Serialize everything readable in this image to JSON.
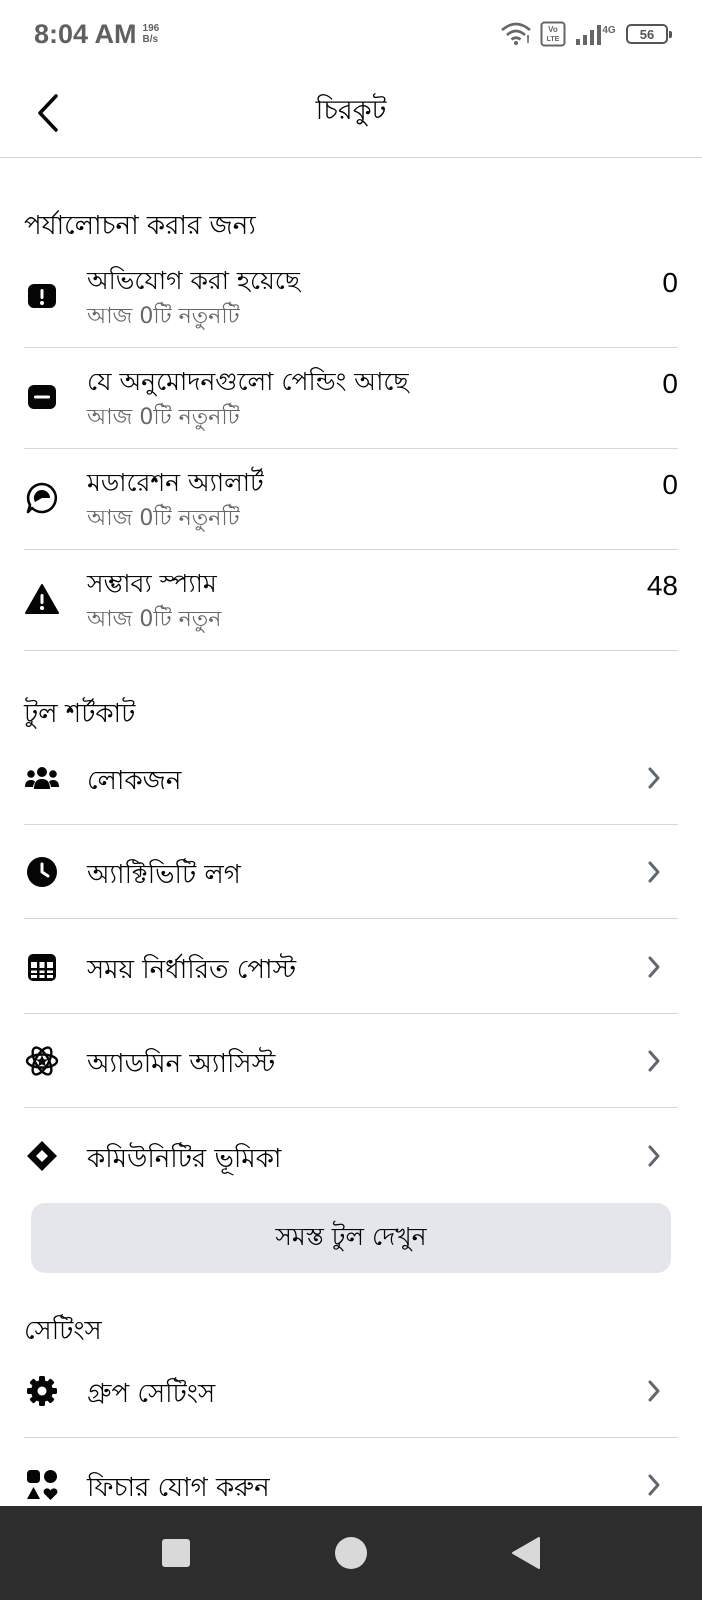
{
  "status_bar": {
    "time": "8:04 AM",
    "net_speed_value": "196",
    "net_speed_unit": "B/s",
    "volte_label": "Vo LTE",
    "network_type": "4G",
    "battery_level": "56"
  },
  "header": {
    "title": "চিরকুট",
    "back_icon": "chevron-left-icon"
  },
  "review": {
    "section_title": "পর্যালোচনা করার জন্য",
    "items": [
      {
        "icon": "report-exclamation-icon",
        "title": "অভিযোগ করা হয়েছে",
        "subtitle": "আজ 0টি নতুনটি",
        "count": "0"
      },
      {
        "icon": "pending-card-icon",
        "title": "যে অনুমোদনগুলো পেন্ডিং আছে",
        "subtitle": "আজ 0টি নতুনটি",
        "count": "0"
      },
      {
        "icon": "moderation-alert-icon",
        "title": "মডারেশন অ্যালার্ট",
        "subtitle": "আজ 0টি নতুনটি",
        "count": "0"
      },
      {
        "icon": "warning-triangle-icon",
        "title": "সম্ভাব্য স্প্যাম",
        "subtitle": "আজ 0টি নতুন",
        "count": "48"
      }
    ]
  },
  "tools": {
    "section_title": "টুল শর্টকাট",
    "items": [
      {
        "icon": "people-icon",
        "label": "লোকজন"
      },
      {
        "icon": "clock-icon",
        "label": "অ্যাক্টিভিটি লগ"
      },
      {
        "icon": "calendar-icon",
        "label": "সময় নির্ধারিত পোস্ট"
      },
      {
        "icon": "admin-assist-icon",
        "label": "অ্যাডমিন অ্যাসিস্ট"
      },
      {
        "icon": "diamond-icon",
        "label": "কমিউনিটির ভূমিকা"
      }
    ],
    "see_all_label": "সমস্ত টুল দেখুন"
  },
  "settings": {
    "section_title": "সেটিংস",
    "items": [
      {
        "icon": "gear-icon",
        "label": "গ্রুপ সেটিংস"
      },
      {
        "icon": "add-features-icon",
        "label": "ফিচার যোগ করুন"
      }
    ]
  },
  "system_nav": {
    "recents_icon": "square-icon",
    "home_icon": "circle-icon",
    "back_icon": "triangle-back-icon"
  }
}
